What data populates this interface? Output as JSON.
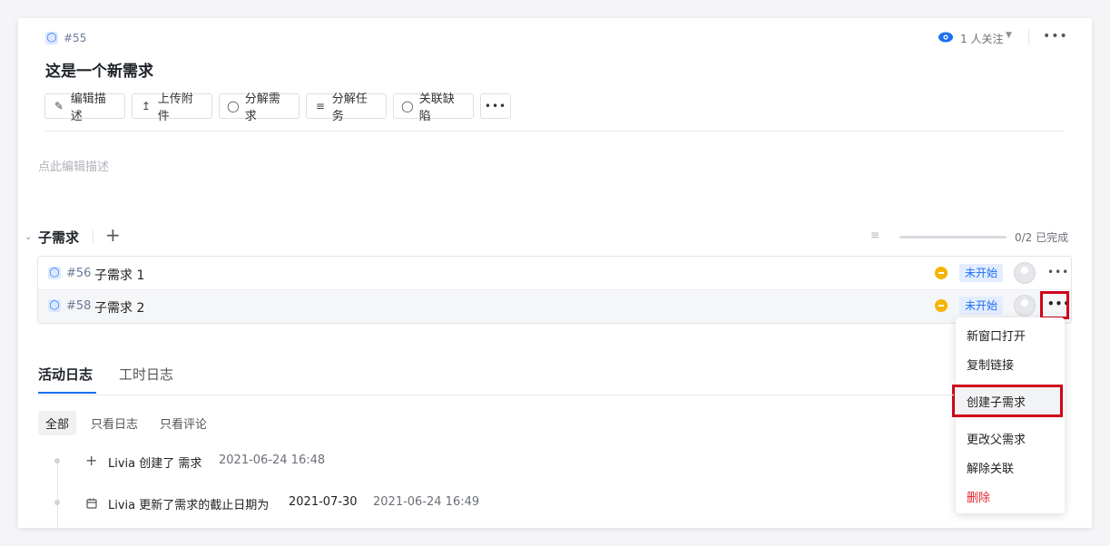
{
  "header": {
    "item_id": "#55",
    "title": "这是一个新需求",
    "followers_label": "1 人关注",
    "eye_icon": "eye-icon",
    "more_icon": "more-horizontal-icon"
  },
  "toolbar": {
    "buttons": [
      {
        "label": "编辑描述",
        "icon": "pencil-icon"
      },
      {
        "label": "上传附件",
        "icon": "upload-icon"
      },
      {
        "label": "分解需求",
        "icon": "bulb-icon"
      },
      {
        "label": "分解任务",
        "icon": "task-list-icon"
      },
      {
        "label": "关联缺陷",
        "icon": "bug-icon"
      }
    ],
    "more_icon": "more-horizontal-icon"
  },
  "description": {
    "placeholder": "点此编辑描述"
  },
  "children": {
    "title": "子需求",
    "progress_label": "0/2 已完成",
    "progress_done": 0,
    "progress_total": 2,
    "items": [
      {
        "id": "#56",
        "name": "子需求 1",
        "status": "未开始"
      },
      {
        "id": "#58",
        "name": "子需求 2",
        "status": "未开始"
      }
    ]
  },
  "context_menu": {
    "items": [
      "新窗口打开",
      "复制链接",
      "创建子需求",
      "更改父需求",
      "解除关联",
      "删除"
    ]
  },
  "activity": {
    "tabs": [
      "活动日志",
      "工时日志"
    ],
    "active_tab": "活动日志",
    "filters": [
      "全部",
      "只看日志",
      "只看评论"
    ],
    "active_filter": "全部",
    "logs": [
      {
        "icon": "plus-icon",
        "text": "Livia 创建了 需求",
        "time": "2021-06-24 16:48"
      },
      {
        "icon": "calendar-icon",
        "text": "Livia 更新了需求的截止日期为",
        "value": "2021-07-30",
        "time": "2021-06-24 16:49"
      }
    ]
  },
  "colors": {
    "accent": "#1b6ef3",
    "status_pending": "#f5b400",
    "highlight": "#d0021b",
    "danger": "#e3242b"
  }
}
